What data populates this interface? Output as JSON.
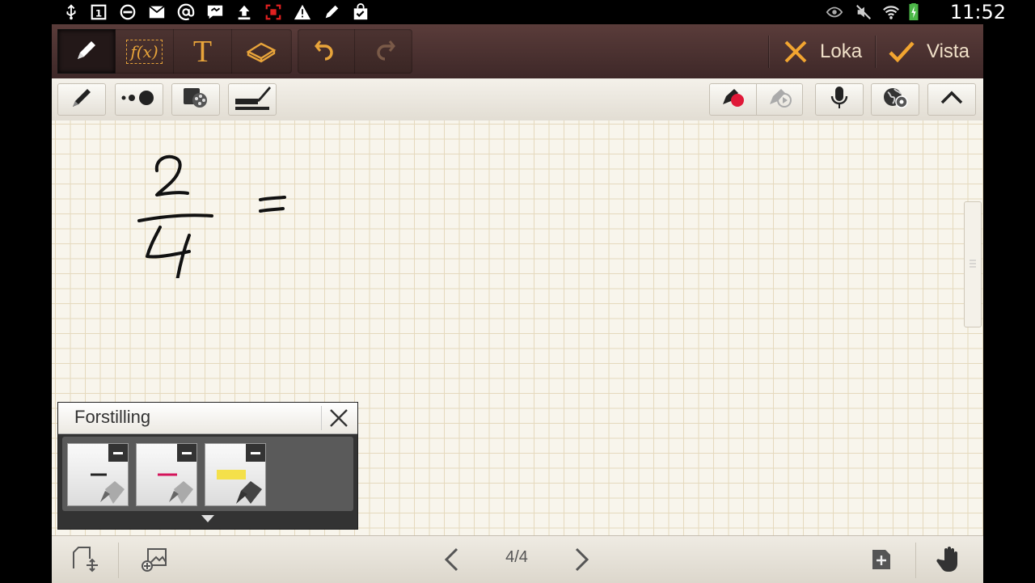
{
  "status_bar": {
    "time": "11:52",
    "left_icons": [
      "usb-icon",
      "calendar-1-icon",
      "dnd-icon",
      "gmail-icon",
      "email-at-icon",
      "messenger-icon",
      "upload-icon",
      "screenshot-icon",
      "warning-icon",
      "pen-icon",
      "bag-check-icon"
    ],
    "right_icons": [
      "eye-icon",
      "mute-icon",
      "wifi-icon",
      "battery-charging-icon"
    ],
    "calendar_day": "1"
  },
  "top_toolbar": {
    "tools": [
      "pen-tool",
      "formula-tool",
      "text-tool",
      "eraser-tool"
    ],
    "formula_label": "f(x)",
    "text_label": "T",
    "cancel_label": "Loka",
    "save_label": "Vista"
  },
  "sub_toolbar": {
    "left": [
      "pen-type",
      "pen-size",
      "pen-color-palette",
      "pen-preview"
    ],
    "right": [
      "record-drawing",
      "play-drawing",
      "voice-memo",
      "background-settings",
      "collapse-toolbar"
    ]
  },
  "canvas": {
    "handwriting": "2/4 ="
  },
  "popup": {
    "title": "Forstilling",
    "presets": [
      {
        "color": "#222222",
        "style": "line"
      },
      {
        "color": "#d4145a",
        "style": "line"
      },
      {
        "color": "#f4e04a",
        "style": "highlight"
      }
    ]
  },
  "bottom_bar": {
    "page_indicator": "4/4"
  },
  "colors": {
    "accent": "#f2a530",
    "toolbar_dark": "#4a3230",
    "grid_line": "#e5d9bd"
  }
}
